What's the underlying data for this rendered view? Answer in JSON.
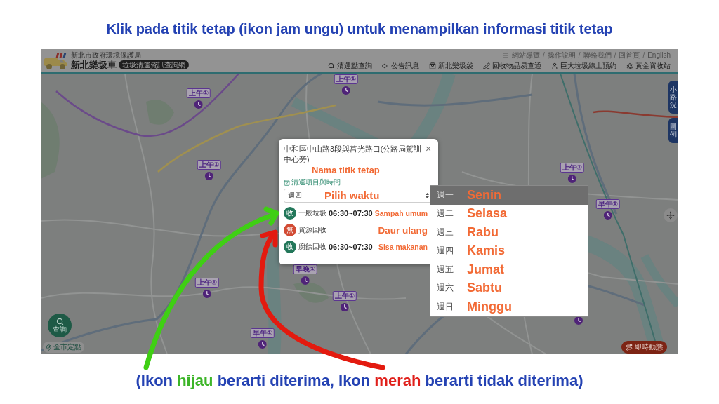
{
  "title": "Klik pada titik tetap (ikon jam ungu) untuk menampilkan informasi titik tetap",
  "site_header": {
    "agency": "新北市政府環境保護局",
    "site_name": "新北樂圾車",
    "site_badge": "垃圾清運資訊查詢網",
    "link_separator": "/",
    "top_links": [
      "網站導覽",
      "操作說明",
      "聯絡我們",
      "回首頁",
      "English"
    ],
    "nav": [
      "清運點查詢",
      "公告訊息",
      "新北樂圾袋",
      "回收物品易查通",
      "巨大垃圾線上預約",
      "黃金資收站"
    ]
  },
  "map": {
    "markers": [
      {
        "label": "上午①"
      },
      {
        "label": "上午①"
      },
      {
        "label": "上午①"
      },
      {
        "label": "上午①"
      },
      {
        "label": "早午①"
      },
      {
        "label": "早晚①"
      },
      {
        "label": "上午①"
      },
      {
        "label": "上午①"
      },
      {
        "label": "早午①"
      }
    ],
    "side_buttons": [
      "小路況",
      "圖例"
    ],
    "search_button": "查詢",
    "all_points_link": "全市定點",
    "live_button": "即時動態"
  },
  "popup": {
    "title": "中和區中山路3段與莒光路口(公路局駕訓中心旁)",
    "title_note": "Nama titik tetap",
    "close": "×",
    "section": "清運項目與時間",
    "select": {
      "value": "週四",
      "note": "Pilih waktu"
    },
    "rows": [
      {
        "badge": "收",
        "accepted": true,
        "item": "一般垃圾",
        "time": "06:30~07:30",
        "note": "Sampah umum"
      },
      {
        "badge": "無",
        "accepted": false,
        "item": "資源回收",
        "note": "Daur ulang"
      },
      {
        "badge": "收",
        "accepted": true,
        "item": "廚餘回收",
        "time": "06:30~07:30",
        "note": "Sisa makanan"
      }
    ]
  },
  "dropdown": {
    "options": [
      {
        "day": "週一",
        "translation": "Senin",
        "highlighted": true
      },
      {
        "day": "週二",
        "translation": "Selasa",
        "highlighted": false
      },
      {
        "day": "週三",
        "translation": "Rabu",
        "highlighted": false
      },
      {
        "day": "週四",
        "translation": "Kamis",
        "highlighted": false
      },
      {
        "day": "週五",
        "translation": "Jumat",
        "highlighted": false
      },
      {
        "day": "週六",
        "translation": "Sabtu",
        "highlighted": false
      },
      {
        "day": "週日",
        "translation": "Minggu",
        "highlighted": false
      }
    ]
  },
  "caption": [
    {
      "text": "(Ikon ",
      "kind": "plain"
    },
    {
      "text": "hijau",
      "kind": "accepted"
    },
    {
      "text": " berarti diterima, Ikon ",
      "kind": "plain"
    },
    {
      "text": "merah",
      "kind": "rejected"
    },
    {
      "text": " berarti tidak diterima)",
      "kind": "plain"
    }
  ]
}
